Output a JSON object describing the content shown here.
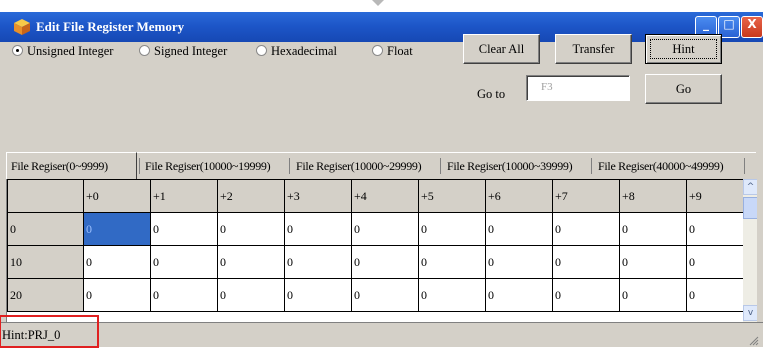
{
  "window": {
    "title": "Edit File Register Memory",
    "controls": {
      "minimize": "_",
      "maximize": "□",
      "close": "X"
    }
  },
  "format_options": [
    {
      "label": "Unsigned Integer",
      "selected": true
    },
    {
      "label": "Signed Integer",
      "selected": false
    },
    {
      "label": "Hexadecimal",
      "selected": false
    },
    {
      "label": "Float",
      "selected": false
    }
  ],
  "buttons": {
    "clear_all": "Clear All",
    "transfer": "Transfer",
    "hint": "Hint",
    "go": "Go"
  },
  "goto": {
    "label": "Go to",
    "value": "F3"
  },
  "tabs": [
    "File Regiser(0~9999)",
    "File Regiser(10000~19999)",
    "File Regiser(10000~29999)",
    "File Regiser(10000~39999)",
    "File Regiser(40000~49999)"
  ],
  "table": {
    "columns": [
      "+0",
      "+1",
      "+2",
      "+3",
      "+4",
      "+5",
      "+6",
      "+7",
      "+8",
      "+9"
    ],
    "rows": [
      {
        "label": "0",
        "values": [
          "0",
          "0",
          "0",
          "0",
          "0",
          "0",
          "0",
          "0",
          "0",
          "0"
        ]
      },
      {
        "label": "10",
        "values": [
          "0",
          "0",
          "0",
          "0",
          "0",
          "0",
          "0",
          "0",
          "0",
          "0"
        ]
      },
      {
        "label": "20",
        "values": [
          "0",
          "0",
          "0",
          "0",
          "0",
          "0",
          "0",
          "0",
          "0",
          "0"
        ]
      }
    ],
    "selected_cell": {
      "row": 0,
      "col": 0
    }
  },
  "scrollbar": {
    "up": "^",
    "down": "v"
  },
  "status": {
    "text": "Hint:PRJ_0"
  },
  "colors": {
    "titlebar": "#1d56c8",
    "selection": "#316ac5",
    "highlight_box": "#e02020",
    "panel": "#d4d0c8"
  }
}
